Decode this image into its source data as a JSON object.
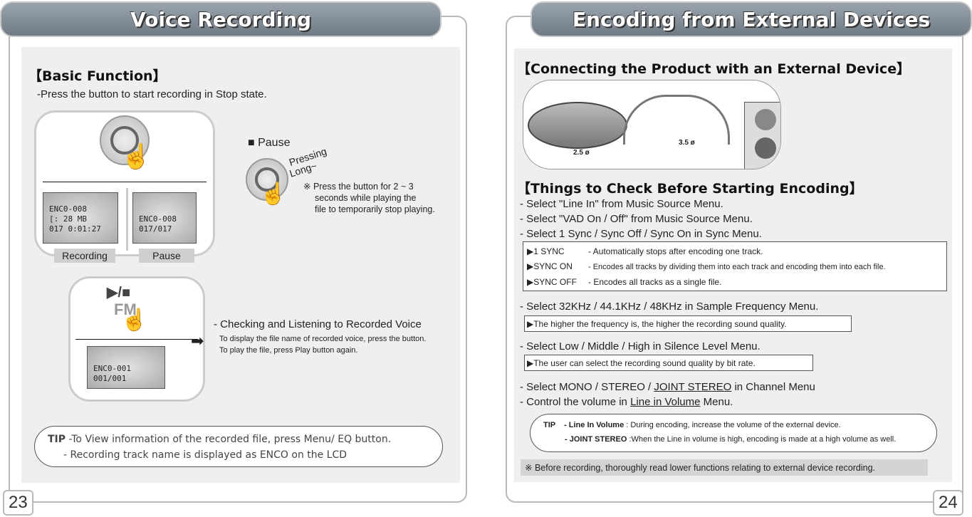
{
  "left": {
    "title": "Voice Recording",
    "section": "【Basic Function】",
    "intro": "-Press the button to start recording in Stop state.",
    "lcd_recording": [
      "ENC0-008",
      "[:  28 MB",
      "017 0:01:27"
    ],
    "lcd_pause": [
      "ENC0-008",
      "017/017"
    ],
    "label_recording": "Recording",
    "label_pause": "Pause",
    "pause_heading": "Pause",
    "pressing": "Pressing",
    "long": "Long~",
    "pause_note": [
      "※ Press the button for 2 ~ 3",
      "seconds while playing the",
      "file to temporarily stop playing."
    ],
    "play_fm_button": "▶/■",
    "fm": "FM",
    "lcd_file": [
      "ENC0-001",
      "001/001"
    ],
    "check_heading": "- Checking and Listening to Recorded Voice",
    "check_lines": [
      "To display the file name of recorded voice, press the button.",
      "To play the file, press Play button again."
    ],
    "tip_label": "TIP",
    "tip_lines": [
      "-To View information of the recorded file, press Menu/ EQ button.",
      "- Recording track name is displayed as ENCO on the LCD"
    ],
    "page_number": "23"
  },
  "right": {
    "title": "Encoding from External Devices",
    "section1": "【Connecting the Product with an External Device】",
    "jack_small": "2.5 ø",
    "jack_large": "3.5 ø",
    "section2": "【Things to Check Before Starting Encoding】",
    "steps1": [
      "- Select \"Line In\" from Music Source Menu.",
      "- Select \"VAD On / Off\" from Music Source Menu.",
      "- Select 1 Sync / Sync Off / Sync On in Sync Menu."
    ],
    "sync_options": [
      {
        "name": "▶1 SYNC",
        "desc": "- Automatically stops after encoding one track."
      },
      {
        "name": "▶SYNC ON",
        "desc": "- Encodes all tracks by dividing them into each track and encoding them into each file."
      },
      {
        "name": "▶SYNC OFF",
        "desc": "- Encodes all tracks as a single file."
      }
    ],
    "step_freq": "- Select 32KHz / 44.1KHz / 48KHz in Sample Frequency Menu.",
    "freq_note": "▶The higher the frequency is, the higher the recording sound quality.",
    "step_silence": "- Select Low / Middle / High in Silence Level Menu.",
    "silence_note": "▶The user can select the recording sound quality by bit rate.",
    "step_channel_pre": "- Select MONO / STEREO / ",
    "step_channel_u": "JOINT STEREO",
    "step_channel_post": " in Channel Menu",
    "step_volume_pre": "- Control the volume in ",
    "step_volume_u": "Line in Volume",
    "step_volume_post": " Menu.",
    "tip_label": "TIP",
    "tip_items": [
      {
        "key": "- Line In Volume",
        "text": ": During encoding, increase the volume of the external device."
      },
      {
        "key": "- JOINT STEREO",
        "text": ":When the Line in volume is high, encoding is made at a high volume as well."
      }
    ],
    "warning": "※ Before recording, thoroughly read lower functions relating to external device recording.",
    "page_number": "24"
  }
}
